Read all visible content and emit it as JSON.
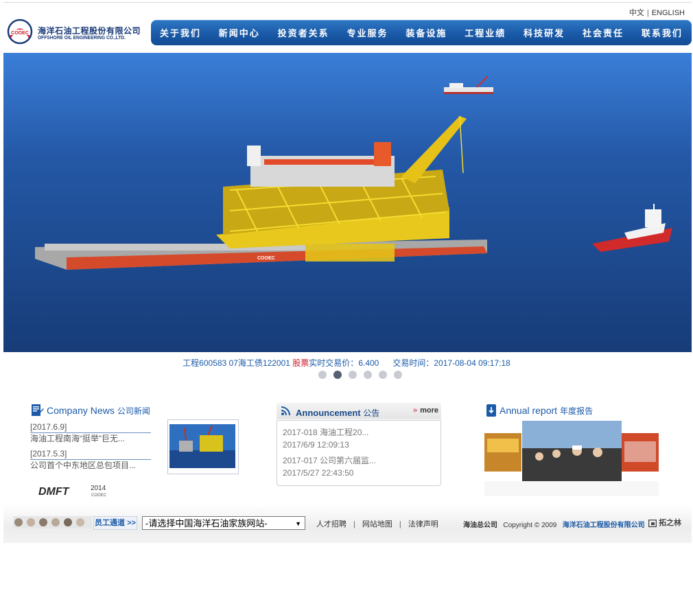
{
  "lang": {
    "cn": "中文",
    "separator": "|",
    "en": "ENGLISH"
  },
  "logo": {
    "cn": "海洋石油工程股份有限公司",
    "en": "OFFSHORE OIL ENGINEERING CO.,LTD.",
    "mark_text": "COOEC"
  },
  "nav": [
    "关于我们",
    "新闻中心",
    "投资者关系",
    "专业服务",
    "装备设施",
    "工程业绩",
    "科技研发",
    "社会责任",
    "联系我们"
  ],
  "banner": {
    "platform_text": "COOEC"
  },
  "ticker": {
    "prefix": "工程600583   07海工债122001   ",
    "stock_red": "股票",
    "price_label": "实时交易价：",
    "price": "6.400",
    "time_label": "交易时间：",
    "time": "2017-08-04 09:17:18"
  },
  "slides": {
    "count": 6,
    "active_index": 1
  },
  "news": {
    "title": "Company News",
    "title_cn": "公司新闻",
    "items": [
      {
        "date": "[2017.6.9]",
        "text": "海油工程南海“挺举”巨无..."
      },
      {
        "date": "[2017.5.3]",
        "text": "公司首个中东地区总包项目..."
      }
    ],
    "dmft_text": "DMFT",
    "dmft_year": "2014",
    "dmft_sub": "COOEC"
  },
  "announcement": {
    "title": "Announcement",
    "title_cn": "公告",
    "more_arrow": "»",
    "more": "more",
    "items": [
      {
        "text": "2017-018 海油工程20...",
        "time": "2017/6/9 12:09:13"
      },
      {
        "text": "2017-017 公司第六届监...",
        "time": "2017/5/27 22:43:50"
      }
    ]
  },
  "annual": {
    "title": "Annual report",
    "title_cn": "年度报告"
  },
  "footer": {
    "staff_button": "员工通道 >>",
    "site_select": "-请选择中国海洋石油家族网站-",
    "links": [
      "人才招聘",
      "网站地图",
      "法律声明"
    ],
    "link_sep": "|",
    "company": "海油总公司",
    "copyright": "Copyright © 2009",
    "company_full": "海洋石油工程股份有限公司",
    "tuozhi": "拓之林"
  }
}
